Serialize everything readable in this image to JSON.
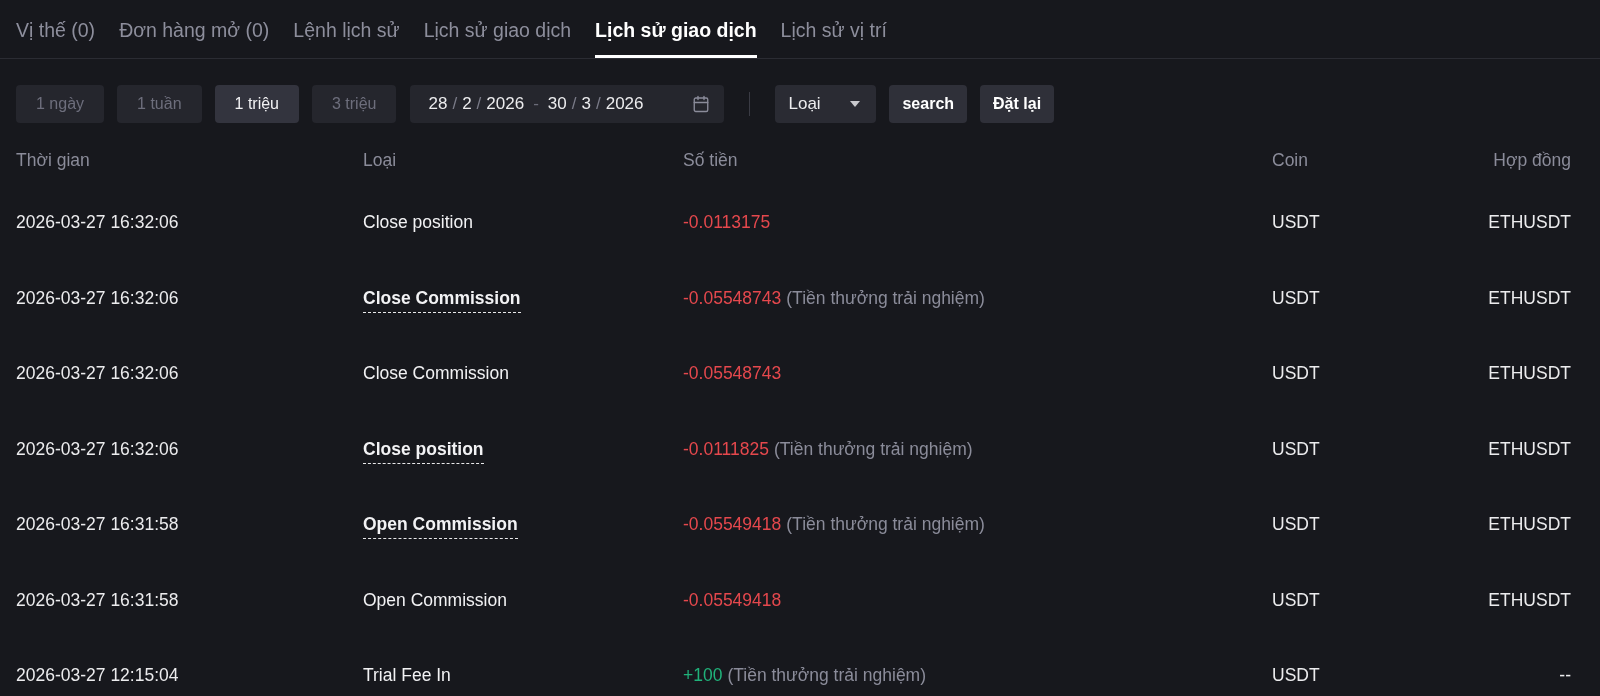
{
  "tabs": [
    {
      "label": "Vị thế (0)",
      "selected": false
    },
    {
      "label": "Đơn hàng mở (0)",
      "selected": false
    },
    {
      "label": "Lệnh lịch sử",
      "selected": false
    },
    {
      "label": "Lịch sử giao dịch",
      "selected": false
    },
    {
      "label": "Lịch sử giao dịch",
      "selected": true
    },
    {
      "label": "Lịch sử vị trí",
      "selected": false
    }
  ],
  "filters": {
    "periods": [
      {
        "label": "1 ngày",
        "selected": false
      },
      {
        "label": "1 tuần",
        "selected": false
      },
      {
        "label": "1 triệu",
        "selected": true
      },
      {
        "label": "3 triệu",
        "selected": false
      }
    ],
    "date_range": {
      "start": [
        {
          "text": "28",
          "kind": "value"
        },
        {
          "text": "/",
          "kind": "separator"
        },
        {
          "text": "2",
          "kind": "value"
        },
        {
          "text": "/",
          "kind": "separator"
        },
        {
          "text": "2026",
          "kind": "value"
        }
      ],
      "separator": "-",
      "end": [
        {
          "text": "30",
          "kind": "value"
        },
        {
          "text": "/",
          "kind": "separator"
        },
        {
          "text": "3",
          "kind": "value"
        },
        {
          "text": "/",
          "kind": "separator"
        },
        {
          "text": "2026",
          "kind": "value"
        }
      ]
    },
    "type_select": {
      "value": "Loại"
    },
    "buttons": [
      "search",
      "Đặt lại"
    ]
  },
  "table": {
    "columns": [
      "Thời gian",
      "Loại",
      "Số tiền",
      "Coin",
      "Hợp đồng"
    ],
    "rows": [
      {
        "time": "2026-03-27 16:32:06",
        "type": "Close position",
        "hinted": false,
        "amount": {
          "value": "-0.0113175",
          "color": "#e5484d"
        },
        "coin": "USDT",
        "contract": "ETHUSDT"
      },
      {
        "time": "2026-03-27 16:32:06",
        "type": "Close Commission",
        "hinted": true,
        "amount": {
          "value": "-0.05548743",
          "color": "#e5484d",
          "note": "(Tiền thưởng trải nghiệm)"
        },
        "coin": "USDT",
        "contract": "ETHUSDT"
      },
      {
        "time": "2026-03-27 16:32:06",
        "type": "Close Commission",
        "hinted": false,
        "amount": {
          "value": "-0.05548743",
          "color": "#e5484d"
        },
        "coin": "USDT",
        "contract": "ETHUSDT"
      },
      {
        "time": "2026-03-27 16:32:06",
        "type": "Close position",
        "hinted": true,
        "amount": {
          "value": "-0.0111825",
          "color": "#e5484d",
          "note": "(Tiền thưởng trải nghiệm)"
        },
        "coin": "USDT",
        "contract": "ETHUSDT"
      },
      {
        "time": "2026-03-27 16:31:58",
        "type": "Open Commission",
        "hinted": true,
        "amount": {
          "value": "-0.05549418",
          "color": "#e5484d",
          "note": "(Tiền thưởng trải nghiệm)"
        },
        "coin": "USDT",
        "contract": "ETHUSDT"
      },
      {
        "time": "2026-03-27 16:31:58",
        "type": "Open Commission",
        "hinted": false,
        "amount": {
          "value": "-0.05549418",
          "color": "#e5484d"
        },
        "coin": "USDT",
        "contract": "ETHUSDT"
      },
      {
        "time": "2026-03-27 12:15:04",
        "type": "Trial Fee In",
        "hinted": false,
        "amount": {
          "value": "+100",
          "color": "#20b27a",
          "note": "(Tiền thưởng trải nghiệm)"
        },
        "coin": "USDT",
        "contract": "--"
      }
    ]
  }
}
